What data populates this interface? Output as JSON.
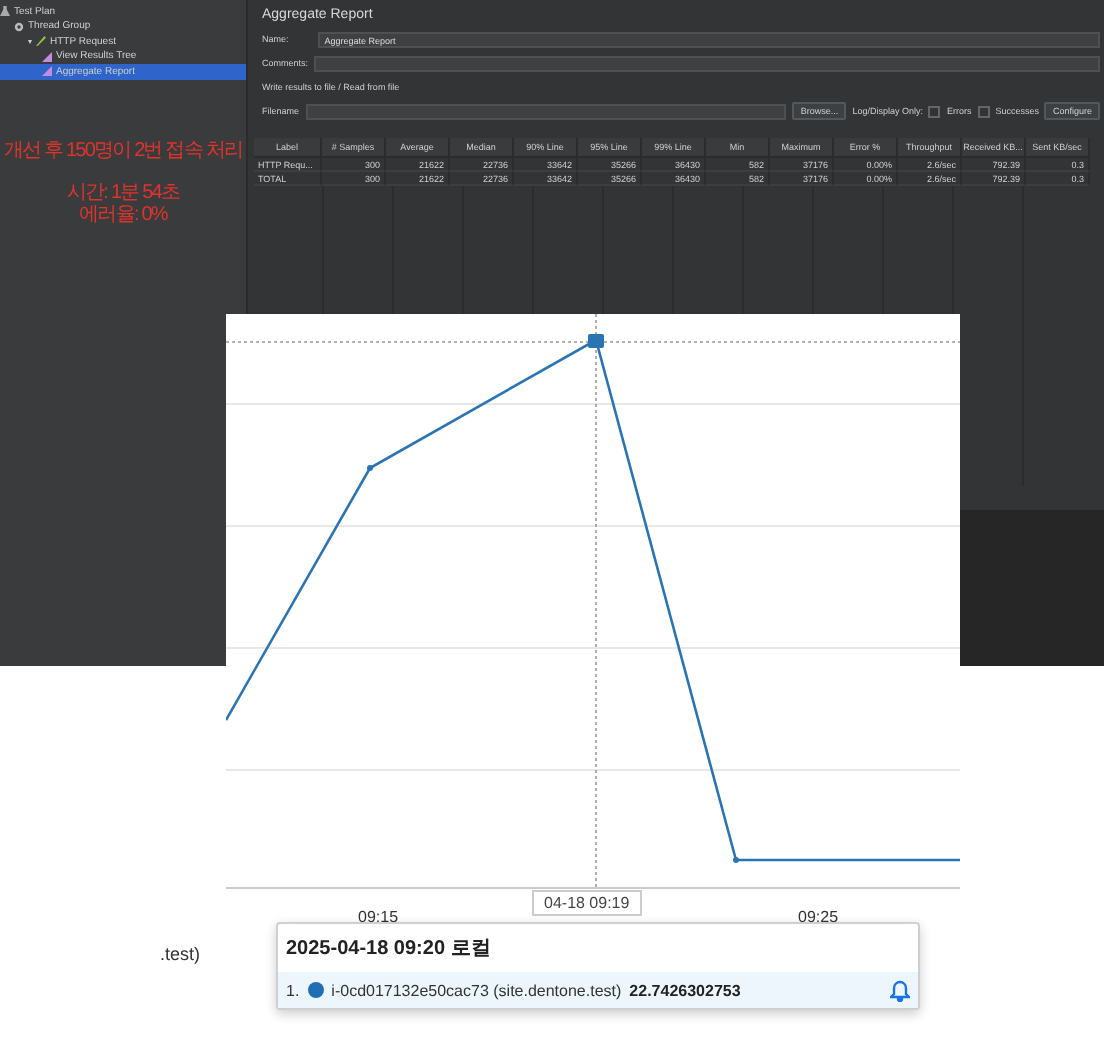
{
  "tree": {
    "items": [
      {
        "label": "Test Plan",
        "kind": "plan",
        "selected": false,
        "children": [
          {
            "label": "Thread Group",
            "kind": "group",
            "selected": false,
            "children": [
              {
                "label": "HTTP Request",
                "kind": "sampler",
                "selected": false,
                "expanded": true,
                "caret": "▾",
                "children": [
                  {
                    "label": "View Results Tree",
                    "kind": "listener",
                    "selected": false
                  },
                  {
                    "label": "Aggregate Report",
                    "kind": "listener",
                    "selected": true
                  }
                ]
              }
            ]
          }
        ]
      }
    ]
  },
  "note": {
    "lines": [
      "개선 후 150명이 2번 접속 처리",
      "시간: 1분 54초",
      "에러율: 0%"
    ]
  },
  "report": {
    "title": "Aggregate Report",
    "name_label": "Name:",
    "name_value": "Aggregate Report",
    "comments_label": "Comments:",
    "file_section": "Write results to file / Read from file",
    "filename_label": "Filename",
    "browse_button": "Browse...",
    "log_label": "Log/Display Only:",
    "errors": {
      "label": "Errors",
      "checked": false
    },
    "successes": {
      "label": "Successes",
      "checked": false
    },
    "configure_button": "Configure",
    "columns": [
      "Label",
      "# Samples",
      "Average",
      "Median",
      "90% Line",
      "95% Line",
      "99% Line",
      "Min",
      "Maximum",
      "Error %",
      "Throughput",
      "Received KB...",
      "Sent KB/sec"
    ],
    "rows": [
      [
        "HTTP Requ...",
        "300",
        "21622",
        "22736",
        "33642",
        "35266",
        "36430",
        "582",
        "37176",
        "0.00%",
        "2.6/sec",
        "792.39",
        "0.3"
      ],
      [
        "TOTAL",
        "300",
        "21622",
        "22736",
        "33642",
        "35266",
        "36430",
        "582",
        "37176",
        "0.00%",
        "2.6/sec",
        "792.39",
        "0.3"
      ]
    ]
  },
  "chart": {
    "xticks": [
      "09:15",
      "09:25"
    ],
    "crosshair_label": "04-18 09:19",
    "legend_fragment": ".test)"
  },
  "tooltip": {
    "title": "2025-04-18 09:20 로컬",
    "items": [
      {
        "index": "1.",
        "color": "#1f6fb2",
        "name": "i-0cd017132e50cac73 (site.dentone.test)",
        "value": "22.7426302753"
      }
    ]
  }
}
